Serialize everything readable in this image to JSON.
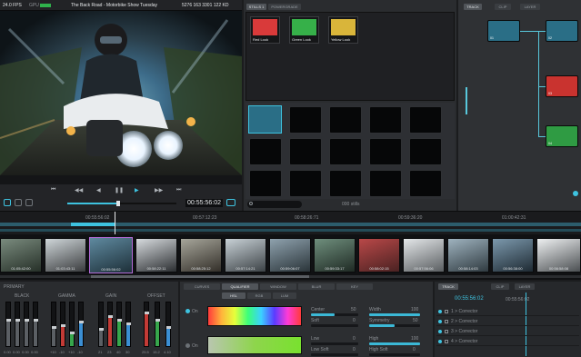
{
  "viewer": {
    "fps": "24.0 FPS",
    "gpu": "GPU",
    "clip_title": "The Back Road - Motorbike Show Tuesday",
    "clip_info": "5276 163 3301 122 KD",
    "timecode": "00:55:56:02",
    "transport": [
      "⏮",
      "◀◀",
      "◀",
      "❚❚",
      "▶",
      "▶▶",
      "⏭"
    ]
  },
  "stills": {
    "tabs": [
      "STILLS 1",
      "POWERGRADE"
    ],
    "items": [
      {
        "label": "Red Look",
        "tint": "#d93a3a"
      },
      {
        "label": "Green Look",
        "tint": "#36b049"
      },
      {
        "label": "Yellow Look",
        "tint": "#d9b53a"
      }
    ],
    "search_placeholder": "",
    "status": "000 stills"
  },
  "nodes": {
    "tabs": [
      "TRACK",
      "CLIP",
      "LAYER"
    ]
  },
  "timeline": {
    "timecodes": [
      "00:55:56:02",
      "00:57:12:23",
      "00:58:26:71",
      "00:59:36:20",
      "01:00:42:31"
    ],
    "clips": [
      "01:05:42:00",
      "01:03:43:11",
      "00:55:56:02",
      "00:58:22:11",
      "00:58:25:12",
      "00:57:14:21",
      "00:59:06:07",
      "00:59:33:17",
      "00:58:02:15",
      "00:57:56:06",
      "00:58:14:03",
      "00:56:38:00",
      "00:56:58:08"
    ]
  },
  "primary": {
    "title": "PRIMARY",
    "groups": [
      "BLACK",
      "GAMMA",
      "GAIN",
      "OFFSET"
    ],
    "values": [
      [
        "0.00",
        "0.00",
        "0.00",
        "0.00"
      ],
      [
        "+10",
        "-10",
        "+10",
        "-10"
      ],
      [
        "21",
        "23",
        "40",
        "30"
      ],
      [
        "25.5",
        "15.2",
        "4.10"
      ]
    ]
  },
  "qualifier": {
    "tabs": [
      "CURVES",
      "QUALIFIER",
      "WINDOW",
      "BLUR",
      "KEY"
    ],
    "subtabs": [
      "HSL",
      "RGB",
      "LUM"
    ],
    "rows": [
      {
        "on": "On",
        "params_l": [
          [
            "Center",
            "50"
          ],
          [
            "Soft",
            "0"
          ]
        ],
        "params_r": [
          [
            "Width",
            "100"
          ],
          [
            "Symmetry",
            "50"
          ]
        ],
        "soft_pct": 0.55
      },
      {
        "on": "On",
        "params_l": [
          [
            "Low",
            "0"
          ],
          [
            "Low Soft",
            "0"
          ]
        ],
        "params_r": [
          [
            "High",
            "100"
          ],
          [
            "High Soft",
            "0"
          ]
        ],
        "soft_pct": 0.35
      }
    ]
  },
  "tracks": {
    "tabs": [
      "TRACK",
      "CLIP",
      "LAYER"
    ],
    "timecode_left": "00:55:56:02",
    "timecode_right": "00:55:56:02",
    "rows": [
      "1 > Corrector",
      "2 > Corrector",
      "3 > Corrector",
      "4 > Corrector"
    ]
  }
}
